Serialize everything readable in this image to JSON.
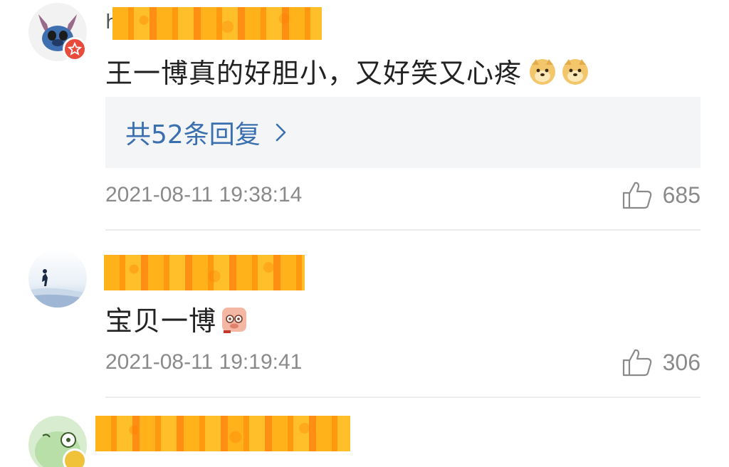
{
  "comments": [
    {
      "username": "",
      "username_prefix": "h",
      "text": "王一博真的好胆小，又好笑又心疼",
      "emojis": [
        "doge",
        "doge"
      ],
      "replies_label": "共52条回复",
      "timestamp": "2021-08-11 19:38:14",
      "likes": "685",
      "vip": true
    },
    {
      "username": "",
      "text": "宝贝一博",
      "emojis": [
        "pig"
      ],
      "timestamp": "2021-08-11 19:19:41",
      "likes": "306",
      "vip": false
    },
    {
      "username": "",
      "vip": true
    }
  ],
  "colors": {
    "link": "#3a6fb0",
    "meta": "#8a8a8a",
    "badge": "#e84a3c",
    "censor": "#ffb21a"
  },
  "icons": [
    "thumbs-up-icon",
    "chevron-right-icon",
    "vip-star-icon"
  ]
}
